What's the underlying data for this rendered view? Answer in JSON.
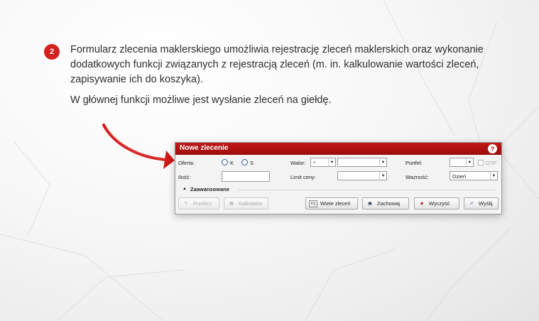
{
  "step": {
    "number": "2"
  },
  "description": {
    "line1": "Formularz zlecenia maklerskiego umożliwia rejestrację zleceń maklerskich oraz wykonanie",
    "line2": "dodatkowych funkcji związanych z rejestracją zleceń (m. in. kalkulowanie wartości zleceń,",
    "line3": "zapisywanie ich do koszyka).",
    "line4": "W głównej funkcji możliwe jest wysłanie zleceń na giełdę."
  },
  "dialog": {
    "title": "Nowe zlecenie",
    "help": "?",
    "oferta_label": "Oferta:",
    "oferta_k": "K",
    "oferta_s": "S",
    "walor_label": "Walor:",
    "walor_prefix": "*",
    "portfel_label": "Portfel:",
    "otp_label": "OTP",
    "ilosc_label": "Ilość:",
    "limit_label": "Limit ceny:",
    "waznosc_label": "Ważność:",
    "waznosc_value": "Dzień",
    "advanced_label": "Zaawansowane"
  },
  "buttons": {
    "przelicz": "Przelicz",
    "kalkulator": "Kalkulator",
    "wiele": "Wiele zleceń",
    "wiele_icon_text": "KS",
    "zachowaj": "Zachowaj",
    "wyczysc": "Wyczyść",
    "wyslij": "Wyślij"
  },
  "colors": {
    "accent": "#d42020",
    "titlebar": "#b01212"
  }
}
